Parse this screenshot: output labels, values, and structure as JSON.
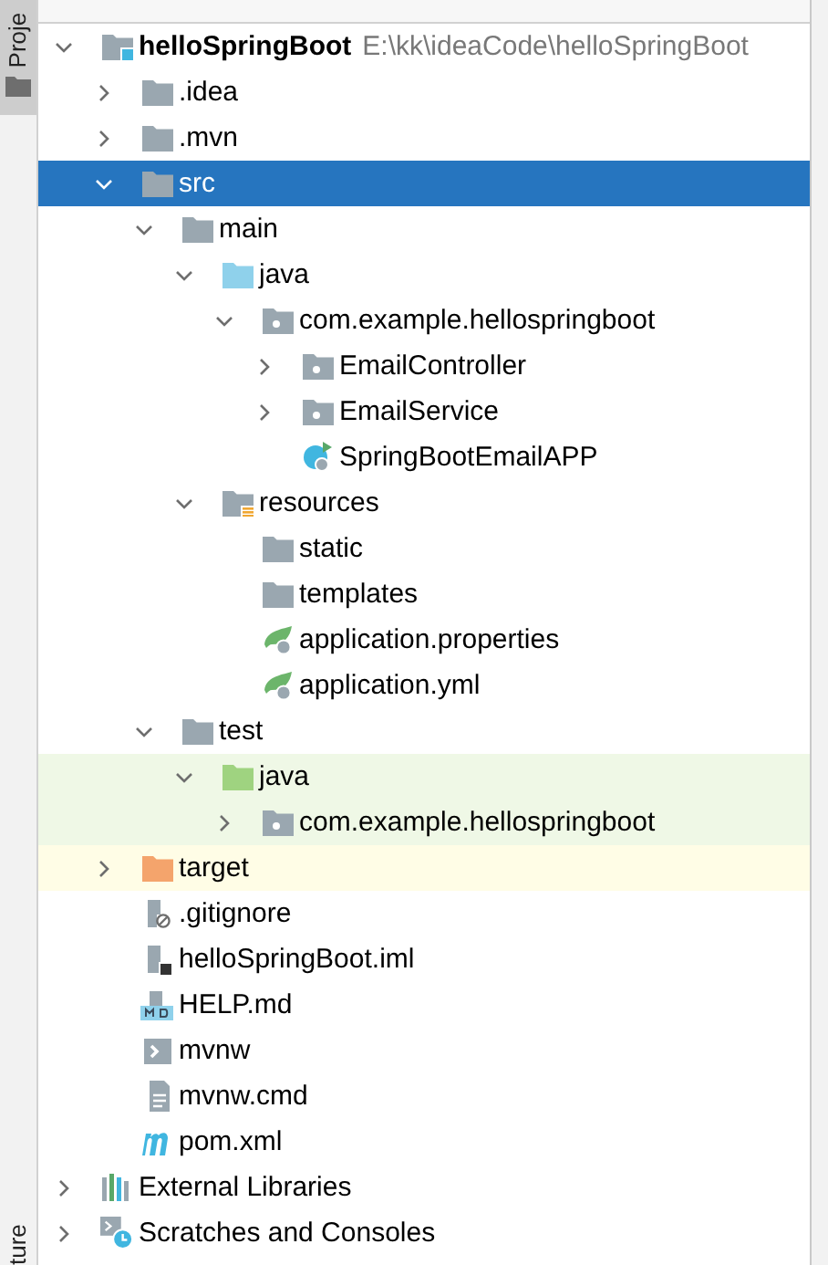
{
  "side_strip": {
    "top_label": "Proje",
    "bottom_label": "ture"
  },
  "tree": [
    {
      "label": "helloSpringBoot",
      "path": "E:\\kk\\ideaCode\\helloSpringBoot",
      "kind": "module",
      "expanded": true,
      "selected": false,
      "children": [
        {
          "label": ".idea",
          "kind": "folder",
          "expanded": false,
          "selected": false
        },
        {
          "label": ".mvn",
          "kind": "folder",
          "expanded": false,
          "selected": false
        },
        {
          "label": "src",
          "kind": "folder",
          "expanded": true,
          "selected": true,
          "children": [
            {
              "label": "main",
              "kind": "folder",
              "expanded": true,
              "selected": false,
              "children": [
                {
                  "label": "java",
                  "kind": "source-folder",
                  "expanded": true,
                  "selected": false,
                  "children": [
                    {
                      "label": "com.example.hellospringboot",
                      "kind": "package",
                      "expanded": true,
                      "selected": false,
                      "children": [
                        {
                          "label": "EmailController",
                          "kind": "package",
                          "expanded": false,
                          "selected": false
                        },
                        {
                          "label": "EmailService",
                          "kind": "package",
                          "expanded": false,
                          "selected": false
                        },
                        {
                          "label": "SpringBootEmailAPP",
                          "kind": "spring-class",
                          "selected": false
                        }
                      ]
                    }
                  ]
                },
                {
                  "label": "resources",
                  "kind": "resources-folder",
                  "expanded": true,
                  "selected": false,
                  "children": [
                    {
                      "label": "static",
                      "kind": "folder",
                      "selected": false
                    },
                    {
                      "label": "templates",
                      "kind": "folder",
                      "selected": false
                    },
                    {
                      "label": "application.properties",
                      "kind": "spring-config",
                      "selected": false
                    },
                    {
                      "label": "application.yml",
                      "kind": "spring-config",
                      "selected": false
                    }
                  ]
                }
              ]
            },
            {
              "label": "test",
              "kind": "folder",
              "expanded": true,
              "selected": false,
              "children": [
                {
                  "label": "java",
                  "kind": "test-folder",
                  "test_scope": true,
                  "expanded": true,
                  "selected": false,
                  "children": [
                    {
                      "label": "com.example.hellospringboot",
                      "kind": "package",
                      "test_scope": true,
                      "expanded": false,
                      "selected": false
                    }
                  ]
                }
              ]
            }
          ]
        },
        {
          "label": "target",
          "kind": "excluded-folder",
          "excluded": true,
          "expanded": false,
          "selected": false
        },
        {
          "label": ".gitignore",
          "kind": "ignore-file",
          "selected": false
        },
        {
          "label": "helloSpringBoot.iml",
          "kind": "module-file",
          "selected": false
        },
        {
          "label": "HELP.md",
          "kind": "markdown-file",
          "selected": false
        },
        {
          "label": "mvnw",
          "kind": "shell-file",
          "selected": false
        },
        {
          "label": "mvnw.cmd",
          "kind": "text-file",
          "selected": false
        },
        {
          "label": "pom.xml",
          "kind": "maven-file",
          "selected": false
        }
      ]
    },
    {
      "label": "External Libraries",
      "kind": "libraries",
      "expanded": false,
      "selected": false
    },
    {
      "label": "Scratches and Consoles",
      "kind": "scratches",
      "expanded": false,
      "selected": false
    }
  ]
}
